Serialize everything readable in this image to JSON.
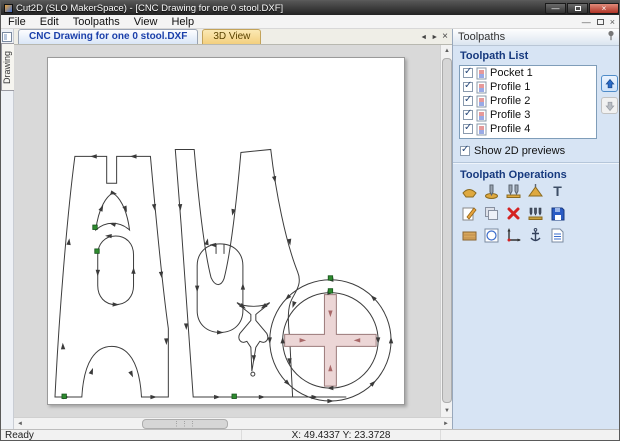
{
  "window": {
    "title": "Cut2D (SLO MakerSpace) - [CNC Drawing for one 0 stool.DXF]"
  },
  "menu": {
    "items": [
      {
        "label": "File"
      },
      {
        "label": "Edit"
      },
      {
        "label": "Toolpaths"
      },
      {
        "label": "View"
      },
      {
        "label": "Help"
      }
    ]
  },
  "side_tab": {
    "label": "Drawing"
  },
  "tabs": [
    {
      "label": "CNC Drawing for one 0 stool.DXF",
      "active": true
    },
    {
      "label": "3D View",
      "active": false
    }
  ],
  "icons": {
    "minimize": "—",
    "close": "×",
    "mdi_minimize": "—",
    "mdi_close": "×",
    "tab_prev": "◄",
    "tab_next": "►",
    "tab_close": "×",
    "scroll_up": "▲",
    "scroll_down": "▼",
    "scroll_left": "◄",
    "scroll_right": "►",
    "hthumb_grip": "⋮⋮⋮"
  },
  "toolpaths_panel": {
    "title": "Toolpaths",
    "list_title": "Toolpath List",
    "items": [
      {
        "label": "Pocket 1",
        "checked": true
      },
      {
        "label": "Profile 1",
        "checked": true
      },
      {
        "label": "Profile 2",
        "checked": true
      },
      {
        "label": "Profile 3",
        "checked": true
      },
      {
        "label": "Profile 4",
        "checked": true
      }
    ],
    "show_previews_label": "Show 2D previews",
    "show_previews_checked": true,
    "operations_title": "Toolpath Operations",
    "operations": [
      "profile-toolpath",
      "pocket-toolpath",
      "drilling-toolpath",
      "quick-engrave-toolpath",
      "text-toolpath",
      "edit-toolpath",
      "duplicate-toolpath",
      "delete-toolpath",
      "recalculate-toolpaths",
      "save-toolpath",
      "material-setup",
      "preview-toolpaths",
      "toolpath-axes",
      "drill-holding",
      "toolpath-summary"
    ]
  },
  "statusbar": {
    "ready": "Ready",
    "coords": "X: 49.4337 Y: 23.3728"
  },
  "canvas": {
    "start_marker_color": "#2e8b2e",
    "toolpath_color": "#3a3a3a",
    "pocket_preview_fill": "#ecd6d6"
  }
}
